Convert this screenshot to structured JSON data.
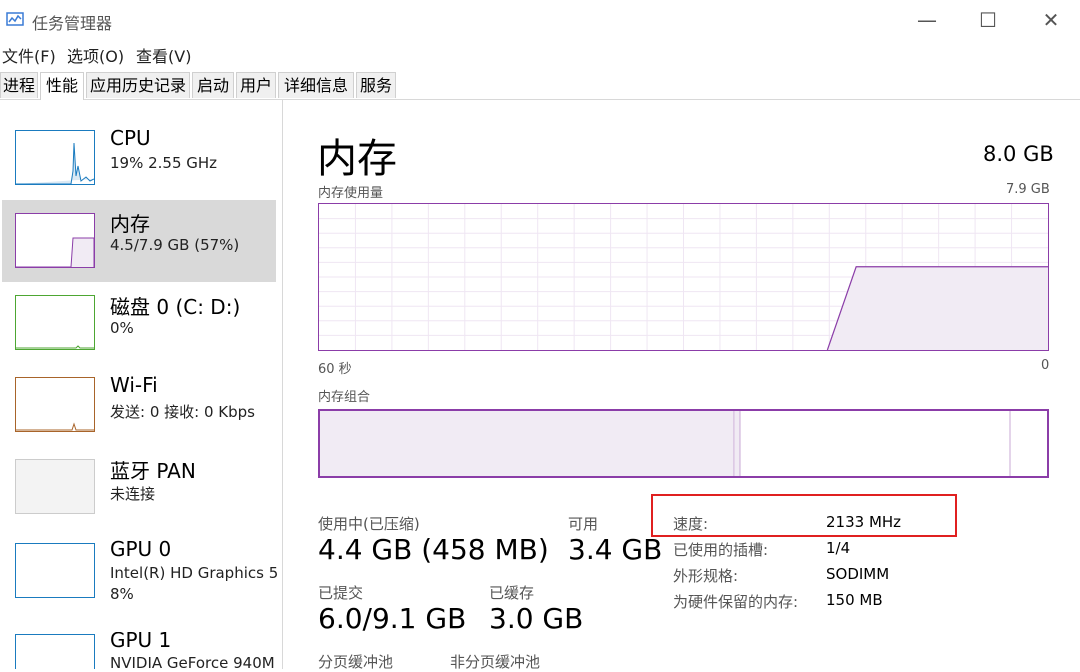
{
  "window": {
    "title": "任务管理器",
    "minimize": "—",
    "maximize": "☐",
    "close": "✕"
  },
  "menu": {
    "file": "文件(F)",
    "options": "选项(O)",
    "view": "查看(V)"
  },
  "tabs": [
    "进程",
    "性能",
    "应用历史记录",
    "启动",
    "用户",
    "详细信息",
    "服务"
  ],
  "active_tab": "性能",
  "sidebar": {
    "items": [
      {
        "title": "CPU",
        "sub1": "19%  2.55 GHz",
        "sub2": "",
        "color": "#1a7bbf"
      },
      {
        "title": "内存",
        "sub1": "4.5/7.9 GB (57%)",
        "sub2": "",
        "color": "#8b3da8"
      },
      {
        "title": "磁盘 0 (C: D:)",
        "sub1": "0%",
        "sub2": "",
        "color": "#4da632"
      },
      {
        "title": "Wi-Fi",
        "sub1": "发送: 0 接收: 0 Kbps",
        "sub2": "",
        "color": "#a8642a"
      },
      {
        "title": "蓝牙 PAN",
        "sub1": "未连接",
        "sub2": "",
        "color": "#bbbbbb"
      },
      {
        "title": "GPU 0",
        "sub1": "Intel(R) HD Graphics 5",
        "sub2": "8%",
        "color": "#1a7bbf"
      },
      {
        "title": "GPU 1",
        "sub1": "NVIDIA GeForce 940M",
        "sub2": "",
        "color": "#1a7bbf"
      }
    ]
  },
  "main": {
    "title": "内存",
    "total": "8.0 GB",
    "usage_label": "内存使用量",
    "usage_max": "7.9 GB",
    "axis_left": "60 秒",
    "axis_right": "0",
    "composition_label": "内存组合",
    "usage_history_pct": [
      0,
      0,
      0,
      0,
      0,
      0,
      0,
      0,
      0,
      0,
      0,
      0,
      0,
      0,
      57,
      57,
      57,
      57,
      57,
      57
    ],
    "stats": {
      "in_use_label": "使用中(已压缩)",
      "in_use_value": "4.4 GB (458 MB)",
      "available_label": "可用",
      "available_value": "3.4 GB",
      "committed_label": "已提交",
      "committed_value": "6.0/9.1 GB",
      "cached_label": "已缓存",
      "cached_value": "3.0 GB",
      "paged_label": "分页缓冲池",
      "nonpaged_label": "非分页缓冲池"
    },
    "details": {
      "speed_label": "速度:",
      "speed_value": "2133 MHz",
      "slots_label": "已使用的插槽:",
      "slots_value": "1/4",
      "form_label": "外形规格:",
      "form_value": "SODIMM",
      "reserved_label": "为硬件保留的内存:",
      "reserved_value": "150 MB"
    }
  },
  "colors": {
    "memory_accent": "#8b3da8",
    "memory_fill": "#f1ebf4",
    "highlight": "#e02020"
  }
}
